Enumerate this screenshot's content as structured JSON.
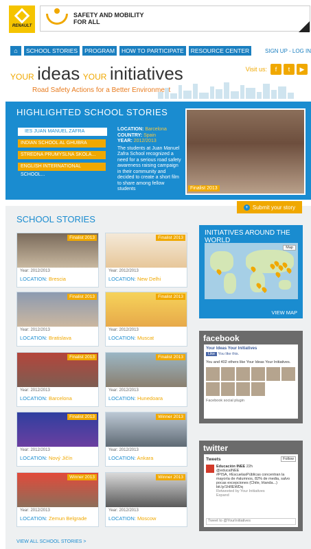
{
  "brand": {
    "logo_text": "RENAULT",
    "banner_line1": "SAFETY AND MOBILITY",
    "banner_line2": "FOR ALL"
  },
  "nav": {
    "items": [
      "SCHOOL STORIES",
      "PROGRAM",
      "HOW TO PARTICIPATE",
      "RESOURCE CENTER"
    ],
    "signup": "SIGN UP - LOG IN"
  },
  "tagline": {
    "your1": "YOUR",
    "ideas": "ideas",
    "your2": "YOUR",
    "initiatives": "initiatives",
    "sub": "Road Safety Actions for a Better Environment"
  },
  "visit": {
    "label": "Visit us:",
    "icons": [
      "facebook-icon",
      "twitter-icon",
      "youtube-icon"
    ]
  },
  "highlight": {
    "title": "HIGHLIGHTED SCHOOL STORIES",
    "schools": [
      "IES JUAN MANUEL ZAFRA",
      "INDIAN SCHOOL AL GHUBRA",
      "STREDNA PRUMYSLNA SKOLA...",
      "ENGLISH INTERNATIONAL SCHOOL..."
    ],
    "location_label": "LOCATION:",
    "location": "Barcelona",
    "country_label": "COUNTRY:",
    "country": "Spain",
    "year_label": "YEAR:",
    "year": "2012/2013",
    "description": "The students at Juan Manuel Zafra School recognized a need for a serious road safety awareness raising campaign in their community and decided to create a short film to share among fellow students",
    "badge": "Finalist 2013"
  },
  "submit": {
    "label": "Submit your story"
  },
  "stories": {
    "title": "SCHOOL STORIES",
    "location_label": "LOCATION:",
    "cards": [
      {
        "badge": "Finalist 2013",
        "year": "Year: 2012/2013",
        "location": "Brescia"
      },
      {
        "badge": "Finalist 2013",
        "year": "Year: 2012/2013",
        "location": "New Delhi"
      },
      {
        "badge": "Finalist 2013",
        "year": "Year: 2012/2013",
        "location": "Bratislava"
      },
      {
        "badge": "Finalist 2013",
        "year": "Year: 2012/2013",
        "location": "Muscat"
      },
      {
        "badge": "Finalist 2013",
        "year": "Year: 2012/2013",
        "location": "Barcelona"
      },
      {
        "badge": "Finalist 2013",
        "year": "Year: 2012/2013",
        "location": "Hunedoara"
      },
      {
        "badge": "Finalist 2013",
        "year": "Year: 2012/2013",
        "location": "Nový Jičín"
      },
      {
        "badge": "Winner 2013",
        "year": "Year: 2012/2013",
        "location": "Ankara"
      },
      {
        "badge": "Winner 2013",
        "year": "Year: 2012/2013",
        "location": "Zemun Belgrade"
      },
      {
        "badge": "Winner 2013",
        "year": "Year: 2012/2013",
        "location": "Moscow"
      }
    ],
    "view_all": "VIEW ALL SCHOOL STORIES >"
  },
  "initiatives": {
    "title": "INITIATIVES AROUND THE WORLD",
    "map_select": "Map",
    "view_map": "VIEW MAP"
  },
  "facebook": {
    "title": "facebook",
    "page_name": "Your Ideas Your Initiatives",
    "like": "Like",
    "like_text": "You like this.",
    "count_text": "You and 402 others like Your Ideas Your Initiatives.",
    "plugin": "Facebook social plugin"
  },
  "twitter": {
    "title": "twitter",
    "header": "Tweets",
    "follow": "Follow",
    "tweet_name": "Educación INEE",
    "tweet_handle": "@educaINEE",
    "tweet_time": "22h",
    "tweet_body": "#PISA, #EscuelasPúblicas concentran la mayoría de #alumnos, 82% de media, salvo pocas excepciones (Chile, Irlanda...) bit.ly/1hREWDq",
    "retweet": "Retweeted by Your Initiatives",
    "extra": "Expand",
    "input": "Tweet to @YourInitiatives"
  }
}
